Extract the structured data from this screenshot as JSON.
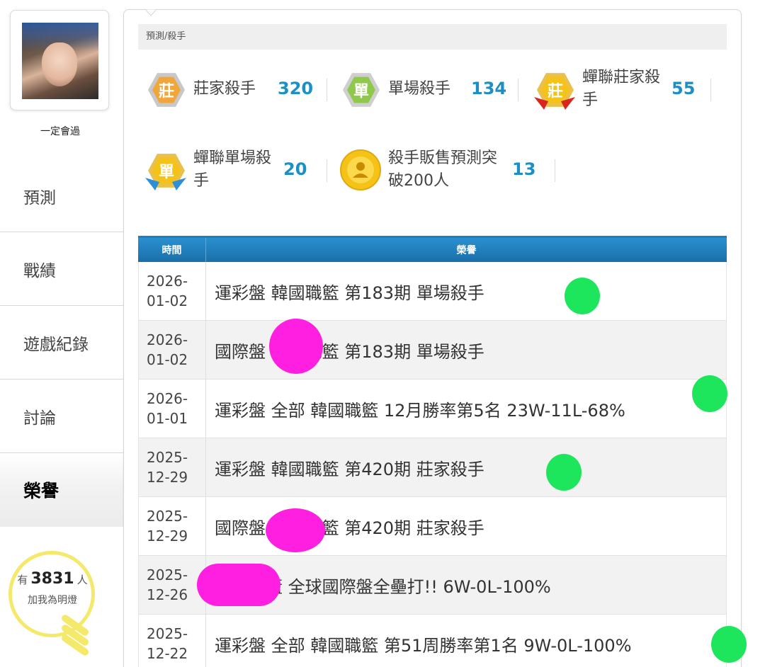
{
  "user": {
    "name": "一定會過"
  },
  "nav": {
    "items": [
      {
        "label": "預測"
      },
      {
        "label": "戰績"
      },
      {
        "label": "遊戲紀錄"
      },
      {
        "label": "討論"
      },
      {
        "label": "榮譽",
        "active": true
      }
    ]
  },
  "fans": {
    "prefix": "有",
    "count": "3831",
    "suffix": "人",
    "text": "加我為明燈"
  },
  "breadcrumb": "預測/殺手",
  "stats": [
    {
      "label": "莊家殺手",
      "count": "320",
      "badge_char": "莊",
      "badge_color": "#f0a63a"
    },
    {
      "label": "單場殺手",
      "count": "134",
      "badge_char": "單",
      "badge_color": "#8fc94b"
    },
    {
      "label": "蟬聯莊家殺手",
      "count": "55",
      "badge_char": "莊",
      "badge_color": "#f5c218"
    },
    {
      "label": "蟬聯單場殺手",
      "count": "20",
      "badge_char": "單",
      "badge_color": "#f5c218"
    },
    {
      "label": "殺手販售預測突破200人",
      "count": "13",
      "badge_color": "#f5c218"
    }
  ],
  "table": {
    "headers": {
      "time": "時間",
      "honor": "榮譽"
    },
    "rows": [
      {
        "date": "2026-\n01-02",
        "date_a": "2026-",
        "date_b": "01-02",
        "honor": "運彩盤 韓國職籃 第183期 單場殺手"
      },
      {
        "date_a": "2026-",
        "date_b": "01-02",
        "honor": "國際盤 韓國職籃 第183期 單場殺手"
      },
      {
        "date_a": "2026-",
        "date_b": "01-01",
        "honor": "運彩盤 全部 韓國職籃 12月勝率第5名 23W-11L-68%"
      },
      {
        "date_a": "2025-",
        "date_b": "12-29",
        "honor": "運彩盤 韓國職籃 第420期 莊家殺手"
      },
      {
        "date_a": "2025-",
        "date_b": "12-29",
        "honor": "國際盤 日本職籃 第420期 莊家殺手"
      },
      {
        "date_a": "2025-",
        "date_b": "12-26",
        "honor": "日本職籃 全球國際盤全壘打!! 6W-0L-100%"
      },
      {
        "date_a": "2025-",
        "date_b": "12-22",
        "honor": "運彩盤 全部 韓國職籃 第51周勝率第1名 9W-0L-100%"
      }
    ]
  },
  "colors": {
    "accent_blue": "#1e8fc4",
    "header_blue": "#1b6fa9",
    "annotation_green": "#1ee65c",
    "annotation_magenta": "#ff1fe0"
  }
}
